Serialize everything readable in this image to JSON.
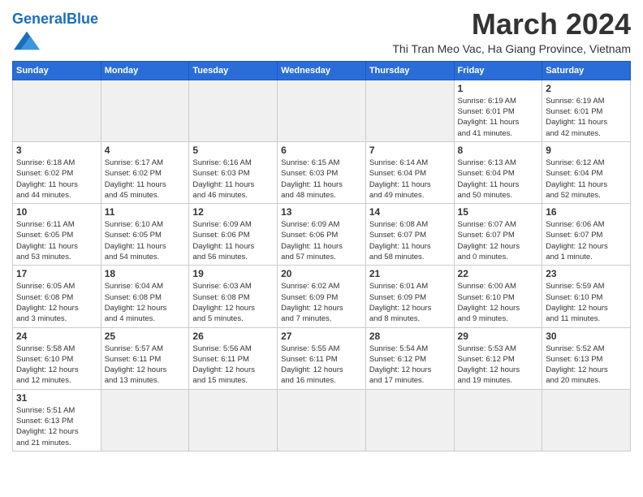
{
  "header": {
    "logo_general": "General",
    "logo_blue": "Blue",
    "month_title": "March 2024",
    "location": "Thi Tran Meo Vac, Ha Giang Province, Vietnam"
  },
  "weekdays": [
    "Sunday",
    "Monday",
    "Tuesday",
    "Wednesday",
    "Thursday",
    "Friday",
    "Saturday"
  ],
  "weeks": [
    [
      {
        "day": "",
        "info": "",
        "empty": true
      },
      {
        "day": "",
        "info": "",
        "empty": true
      },
      {
        "day": "",
        "info": "",
        "empty": true
      },
      {
        "day": "",
        "info": "",
        "empty": true
      },
      {
        "day": "",
        "info": "",
        "empty": true
      },
      {
        "day": "1",
        "info": "Sunrise: 6:19 AM\nSunset: 6:01 PM\nDaylight: 11 hours\nand 41 minutes."
      },
      {
        "day": "2",
        "info": "Sunrise: 6:19 AM\nSunset: 6:01 PM\nDaylight: 11 hours\nand 42 minutes."
      }
    ],
    [
      {
        "day": "3",
        "info": "Sunrise: 6:18 AM\nSunset: 6:02 PM\nDaylight: 11 hours\nand 44 minutes."
      },
      {
        "day": "4",
        "info": "Sunrise: 6:17 AM\nSunset: 6:02 PM\nDaylight: 11 hours\nand 45 minutes."
      },
      {
        "day": "5",
        "info": "Sunrise: 6:16 AM\nSunset: 6:03 PM\nDaylight: 11 hours\nand 46 minutes."
      },
      {
        "day": "6",
        "info": "Sunrise: 6:15 AM\nSunset: 6:03 PM\nDaylight: 11 hours\nand 48 minutes."
      },
      {
        "day": "7",
        "info": "Sunrise: 6:14 AM\nSunset: 6:04 PM\nDaylight: 11 hours\nand 49 minutes."
      },
      {
        "day": "8",
        "info": "Sunrise: 6:13 AM\nSunset: 6:04 PM\nDaylight: 11 hours\nand 50 minutes."
      },
      {
        "day": "9",
        "info": "Sunrise: 6:12 AM\nSunset: 6:04 PM\nDaylight: 11 hours\nand 52 minutes."
      }
    ],
    [
      {
        "day": "10",
        "info": "Sunrise: 6:11 AM\nSunset: 6:05 PM\nDaylight: 11 hours\nand 53 minutes."
      },
      {
        "day": "11",
        "info": "Sunrise: 6:10 AM\nSunset: 6:05 PM\nDaylight: 11 hours\nand 54 minutes."
      },
      {
        "day": "12",
        "info": "Sunrise: 6:09 AM\nSunset: 6:06 PM\nDaylight: 11 hours\nand 56 minutes."
      },
      {
        "day": "13",
        "info": "Sunrise: 6:09 AM\nSunset: 6:06 PM\nDaylight: 11 hours\nand 57 minutes."
      },
      {
        "day": "14",
        "info": "Sunrise: 6:08 AM\nSunset: 6:07 PM\nDaylight: 11 hours\nand 58 minutes."
      },
      {
        "day": "15",
        "info": "Sunrise: 6:07 AM\nSunset: 6:07 PM\nDaylight: 12 hours\nand 0 minutes."
      },
      {
        "day": "16",
        "info": "Sunrise: 6:06 AM\nSunset: 6:07 PM\nDaylight: 12 hours\nand 1 minute."
      }
    ],
    [
      {
        "day": "17",
        "info": "Sunrise: 6:05 AM\nSunset: 6:08 PM\nDaylight: 12 hours\nand 3 minutes."
      },
      {
        "day": "18",
        "info": "Sunrise: 6:04 AM\nSunset: 6:08 PM\nDaylight: 12 hours\nand 4 minutes."
      },
      {
        "day": "19",
        "info": "Sunrise: 6:03 AM\nSunset: 6:08 PM\nDaylight: 12 hours\nand 5 minutes."
      },
      {
        "day": "20",
        "info": "Sunrise: 6:02 AM\nSunset: 6:09 PM\nDaylight: 12 hours\nand 7 minutes."
      },
      {
        "day": "21",
        "info": "Sunrise: 6:01 AM\nSunset: 6:09 PM\nDaylight: 12 hours\nand 8 minutes."
      },
      {
        "day": "22",
        "info": "Sunrise: 6:00 AM\nSunset: 6:10 PM\nDaylight: 12 hours\nand 9 minutes."
      },
      {
        "day": "23",
        "info": "Sunrise: 5:59 AM\nSunset: 6:10 PM\nDaylight: 12 hours\nand 11 minutes."
      }
    ],
    [
      {
        "day": "24",
        "info": "Sunrise: 5:58 AM\nSunset: 6:10 PM\nDaylight: 12 hours\nand 12 minutes."
      },
      {
        "day": "25",
        "info": "Sunrise: 5:57 AM\nSunset: 6:11 PM\nDaylight: 12 hours\nand 13 minutes."
      },
      {
        "day": "26",
        "info": "Sunrise: 5:56 AM\nSunset: 6:11 PM\nDaylight: 12 hours\nand 15 minutes."
      },
      {
        "day": "27",
        "info": "Sunrise: 5:55 AM\nSunset: 6:11 PM\nDaylight: 12 hours\nand 16 minutes."
      },
      {
        "day": "28",
        "info": "Sunrise: 5:54 AM\nSunset: 6:12 PM\nDaylight: 12 hours\nand 17 minutes."
      },
      {
        "day": "29",
        "info": "Sunrise: 5:53 AM\nSunset: 6:12 PM\nDaylight: 12 hours\nand 19 minutes."
      },
      {
        "day": "30",
        "info": "Sunrise: 5:52 AM\nSunset: 6:13 PM\nDaylight: 12 hours\nand 20 minutes."
      }
    ],
    [
      {
        "day": "31",
        "info": "Sunrise: 5:51 AM\nSunset: 6:13 PM\nDaylight: 12 hours\nand 21 minutes."
      },
      {
        "day": "",
        "info": "",
        "empty": true
      },
      {
        "day": "",
        "info": "",
        "empty": true
      },
      {
        "day": "",
        "info": "",
        "empty": true
      },
      {
        "day": "",
        "info": "",
        "empty": true
      },
      {
        "day": "",
        "info": "",
        "empty": true
      },
      {
        "day": "",
        "info": "",
        "empty": true
      }
    ]
  ]
}
